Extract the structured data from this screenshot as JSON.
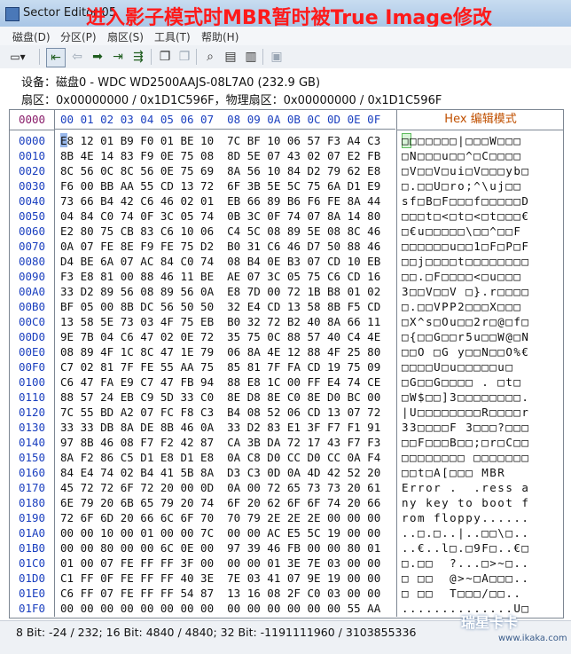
{
  "window": {
    "title": "Sector Editor",
    "title_suffix": "05",
    "overlay_caption": "进入影子模式时MBR暂时被True Image修改"
  },
  "menu": [
    "磁盘(D)",
    "分区(P)",
    "扇区(S)",
    "工具(T)",
    "帮助(H)"
  ],
  "toolbar": {
    "buttons": [
      "dropdown-icon",
      "first-sector-icon",
      "back-icon",
      "forward-icon",
      "next-icon",
      "last-sector-icon",
      "copy-icon",
      "paste-icon",
      "find-icon",
      "export-icon",
      "import-icon",
      "save-icon"
    ]
  },
  "info": {
    "device": "设备：磁盘0 - WDC WD2500AAJS-08L7A0 (232.9 GB)",
    "sector": "扇区：0x00000000 / 0x1D1C596F，物理扇区：0x00000000 / 0x1D1C596F"
  },
  "header": {
    "offset": "0000",
    "bytes": "00 01 02 03 04 05 06 07  08 09 0A 0B 0C 0D 0E 0F",
    "ascii_prefix": "Hex",
    "ascii_label": "编辑模式"
  },
  "rows": [
    {
      "offset": "0000",
      "bytes": "E8 12 01 B9 F0 01 BE 10  7C BF 10 06 57 F3 A4 C3",
      "ascii": "□□□□□□□|□□□W□□□"
    },
    {
      "offset": "0010",
      "bytes": "8B 4E 14 83 F9 0E 75 08  8D 5E 07 43 02 07 E2 FB",
      "ascii": "□N□□□u□□^□C□□□□"
    },
    {
      "offset": "0020",
      "bytes": "8C 56 0C 8C 56 0E 75 69  8A 56 10 84 D2 79 62 E8",
      "ascii": "□V□□V□ui□V□□□yb□"
    },
    {
      "offset": "0030",
      "bytes": "F6 00 BB AA 55 CD 13 72  6F 3B 5E 5C 75 6A D1 E9",
      "ascii": "□.□□U□ro;^\\uj□□"
    },
    {
      "offset": "0040",
      "bytes": "73 66 B4 42 C6 46 02 01  EB 66 89 B6 F6 FE 8A 44",
      "ascii": "sf□B□F□□□f□□□□□D"
    },
    {
      "offset": "0050",
      "bytes": "04 84 C0 74 0F 3C 05 74  0B 3C 0F 74 07 8A 14 80",
      "ascii": "□□□t□<□t□<□t□□□€"
    },
    {
      "offset": "0060",
      "bytes": "E2 80 75 CB 83 C6 10 06  C4 5C 08 89 5E 08 8C 46",
      "ascii": "□€u□□□□□\\□□^□□F"
    },
    {
      "offset": "0070",
      "bytes": "0A 07 FE 8E F9 FE 75 D2  B0 31 C6 46 D7 50 88 46",
      "ascii": "□□□□□□u□□1□F□P□F"
    },
    {
      "offset": "0080",
      "bytes": "D4 BE 6A 07 AC 84 C0 74  08 B4 0E B3 07 CD 10 EB",
      "ascii": "□□j□□□□t□□□□□□□□"
    },
    {
      "offset": "0090",
      "bytes": "F3 E8 81 00 88 46 11 BE  AE 07 3C 05 75 C6 CD 16",
      "ascii": "□□.□F□□□□<□u□□□"
    },
    {
      "offset": "00A0",
      "bytes": "33 D2 89 56 08 89 56 0A  E8 7D 00 72 1B B8 01 02",
      "ascii": "3□□V□□V □}.r□□□□"
    },
    {
      "offset": "00B0",
      "bytes": "BF 05 00 8B DC 56 50 50  32 E4 CD 13 58 8B F5 CD",
      "ascii": "□.□□VPP2□□□X□□□"
    },
    {
      "offset": "00C0",
      "bytes": "13 58 5E 73 03 4F 75 EB  B0 32 72 B2 40 8A 66 11",
      "ascii": "□X^s□Ou□□2r□@□f□"
    },
    {
      "offset": "00D0",
      "bytes": "9E 7B 04 C6 47 02 0E 72  35 75 0C 88 57 40 C4 4E",
      "ascii": "□{□□G□□r5u□□W@□N"
    },
    {
      "offset": "00E0",
      "bytes": "08 89 4F 1C 8C 47 1E 79  06 8A 4E 12 88 4F 25 80",
      "ascii": "□□O □G y□□N□□O%€"
    },
    {
      "offset": "00F0",
      "bytes": "C7 02 81 7F FE 55 AA 75  85 81 7F FA CD 19 75 09",
      "ascii": "□□□□U□u□□□□□u□"
    },
    {
      "offset": "0100",
      "bytes": "C6 47 FA E9 C7 47 FB 94  88 E8 1C 00 FF E4 74 CE",
      "ascii": "□G□□G□□□□ . □t□"
    },
    {
      "offset": "0110",
      "bytes": "88 57 24 EB C9 5D 33 C0  8E D8 8E C0 8E D0 BC 00",
      "ascii": "□W$□□]3□□□□□□□□."
    },
    {
      "offset": "0120",
      "bytes": "7C 55 BD A2 07 FC F8 C3  B4 08 52 06 CD 13 07 72",
      "ascii": "|U□□□□□□□□R□□□□r"
    },
    {
      "offset": "0130",
      "bytes": "33 33 DB 8A DE 8B 46 0A  33 D2 83 E1 3F F7 F1 91",
      "ascii": "33□□□□F 3□□□?□□□"
    },
    {
      "offset": "0140",
      "bytes": "97 8B 46 08 F7 F2 42 87  CA 3B DA 72 17 43 F7 F3",
      "ascii": "□□F□□□B□□;□r□C□□"
    },
    {
      "offset": "0150",
      "bytes": "8A F2 86 C5 D1 E8 D1 E8  0A C8 D0 CC D0 CC 0A F4",
      "ascii": "□□□□□□□□ □□□□□□□"
    },
    {
      "offset": "0160",
      "bytes": "84 E4 74 02 B4 41 5B 8A  D3 C3 0D 0A 4D 42 52 20",
      "ascii": "□□t□A[□□□ MBR "
    },
    {
      "offset": "0170",
      "bytes": "45 72 72 6F 72 20 00 0D  0A 00 72 65 73 73 20 61",
      "ascii": "Error .  .ress a"
    },
    {
      "offset": "0180",
      "bytes": "6E 79 20 6B 65 79 20 74  6F 20 62 6F 6F 74 20 66",
      "ascii": "ny key to boot f"
    },
    {
      "offset": "0190",
      "bytes": "72 6F 6D 20 66 6C 6F 70  70 79 2E 2E 2E 00 00 00",
      "ascii": "rom floppy......"
    },
    {
      "offset": "01A0",
      "bytes": "00 00 10 00 01 00 00 7C  00 00 AC E5 5C 19 00 00",
      "ascii": "..□.□..|..□□\\□.."
    },
    {
      "offset": "01B0",
      "bytes": "00 00 80 00 00 6C 0E 00  97 39 46 FB 00 00 80 01",
      "ascii": "..€..l□.□9F□..€□"
    },
    {
      "offset": "01C0",
      "bytes": "01 00 07 FE FF FF 3F 00  00 00 01 3E 7E 03 00 00",
      "ascii": "□.□□  ?...□>~□.."
    },
    {
      "offset": "01D0",
      "bytes": "C1 FF 0F FE FF FF 40 3E  7E 03 41 07 9E 19 00 00",
      "ascii": "□ □□  @>~□A□□□.."
    },
    {
      "offset": "01E0",
      "bytes": "C6 FF 07 FE FF FF 54 87  13 16 08 2F C0 03 00 00",
      "ascii": "□ □□  T□□□/□□.."
    },
    {
      "offset": "01F0",
      "bytes": "00 00 00 00 00 00 00 00  00 00 00 00 00 00 55 AA",
      "ascii": "..............U□"
    }
  ],
  "status": "8 Bit: -24 / 232;  16 Bit: 4840 / 4840;  32 Bit: -1191111960 / 3103855336",
  "watermark": {
    "brand": "瑞星卡卡",
    "url": "www.ikaka.com"
  }
}
